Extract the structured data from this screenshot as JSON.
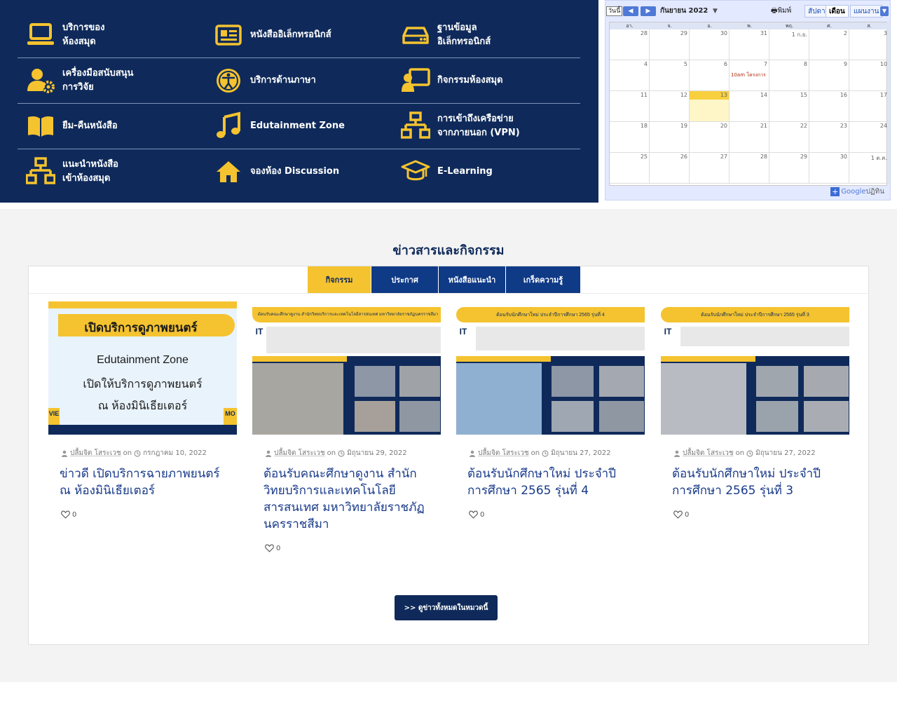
{
  "services": [
    {
      "label": "บริการของ\nห้องสมุด",
      "icon": "laptop-icon"
    },
    {
      "label": "หนังสืออิเล็กทรอนิกส์",
      "icon": "newspaper-icon"
    },
    {
      "label": "ฐานข้อมูล\nอิเล็กทรอนิกส์",
      "icon": "hard-drive-icon"
    },
    {
      "label": "เครื่องมือสนับสนุน\nการวิจัย",
      "icon": "user-gear-icon"
    },
    {
      "label": "บริการด้านภาษา",
      "icon": "accessibility-icon"
    },
    {
      "label": "กิจกรรมห้องสมุด",
      "icon": "presentation-icon"
    },
    {
      "label": "ยืม-คืนหนังสือ",
      "icon": "open-book-icon"
    },
    {
      "label": "Edutainment Zone",
      "icon": "music-note-icon"
    },
    {
      "label": "การเข้าถึงเครือข่าย\nจากภายนอก (VPN)",
      "icon": "network-icon"
    },
    {
      "label": "แนะนำหนังสือ\nเข้าห้องสมุด",
      "icon": "sitemap-icon"
    },
    {
      "label": "จองห้อง Discussion",
      "icon": "home-icon"
    },
    {
      "label": "E-Learning",
      "icon": "graduation-cap-icon"
    }
  ],
  "calendar": {
    "today_button": "วันนี้",
    "prev": "◀",
    "next": "▶",
    "month_label": "กันยายน 2022",
    "print_label": "พิมพ์",
    "view_tabs": [
      "สัปดาห์",
      "เดือน",
      "แผนงาน"
    ],
    "weekdays": [
      "อา.",
      "จ.",
      "อ.",
      "พ.",
      "พฤ.",
      "ศ.",
      "ส."
    ],
    "weeks": [
      [
        "28",
        "29",
        "30",
        "31",
        "1 ก.ย.",
        "2",
        "3"
      ],
      [
        "4",
        "5",
        "6",
        "7",
        "8",
        "9",
        "10"
      ],
      [
        "11",
        "12",
        "13",
        "14",
        "15",
        "16",
        "17"
      ],
      [
        "18",
        "19",
        "20",
        "21",
        "22",
        "23",
        "24"
      ],
      [
        "25",
        "26",
        "27",
        "28",
        "29",
        "30",
        "1 ต.ค."
      ]
    ],
    "today": {
      "week": 2,
      "day": 2
    },
    "event": {
      "week": 1,
      "day": 3,
      "text": "10am โครงการ"
    },
    "google_label": "Google",
    "google_suffix": "ปฏิทิน"
  },
  "news": {
    "title": "ข่าวสารและกิจกรรม",
    "tabs": [
      "กิจกรรม",
      "ประกาศ",
      "หนังสือแนะนำ",
      "เกร็ดความรู้"
    ],
    "active_tab": 0,
    "posts": [
      {
        "author": "ปลื้มจิต โสระเวช",
        "on": "on",
        "date": "กรกฎาคม 10, 2022",
        "title": "ข่าวดี เปิดบริการฉายภาพยนตร์ ณ ห้องมินิเธียเตอร์",
        "likes": "0",
        "thumb": {
          "heading": "เปิดบริการดูภาพยนตร์",
          "line1": "Edutainment Zone",
          "line2": "เปิดให้บริการดูภาพยนตร์",
          "line3": "ณ ห้องมินิเธียเตอร์",
          "left_tag": "VIE",
          "right_tag": "MO"
        }
      },
      {
        "author": "ปลื้มจิต โสระเวช",
        "on": "on",
        "date": "มิถุนายน 29, 2022",
        "title": "ต้อนรับคณะศึกษาดูงาน สำนักวิทยบริการและเทคโนโลยีสารสนเทศ มหาวิทยาลัยราชภัฏนครราชสีมา",
        "likes": "0",
        "thumb": {
          "heading": "ต้อนรับคณะศึกษาดูงาน สำนักวิทยบริการและเทคโนโลยีสารสนเทศ มหาวิทยาลัยราชภัฏนครราชสีมา",
          "logo": "IT"
        }
      },
      {
        "author": "ปลื้มจิต โสระเวช",
        "on": "on",
        "date": "มิถุนายน 27, 2022",
        "title": "ต้อนรับนักศึกษาใหม่ ประจำปีการศึกษา 2565 รุ่นที่ 4",
        "likes": "0",
        "thumb": {
          "heading": "ต้อนรับนักศึกษาใหม่ ประจำปีการศึกษา 2565  รุ่นที่ 4",
          "logo": "IT"
        }
      },
      {
        "author": "ปลื้มจิต โสระเวช",
        "on": "on",
        "date": "มิถุนายน 27, 2022",
        "title": "ต้อนรับนักศึกษาใหม่ ประจำปีการศึกษา 2565 รุ่นที่ 3",
        "likes": "0",
        "thumb": {
          "heading": "ต้อนรับนักศึกษาใหม่ ประจำปีการศึกษา 2565  รุ่นที่ 3",
          "logo": "IT"
        }
      }
    ],
    "all_button": ">> ดูข่าวทั้งหมดในหมวดนี้"
  },
  "colors": {
    "navy": "#0f2a5a",
    "accent_yellow": "#f4c32f",
    "tab_blue": "#0f3a86",
    "title_blue": "#183a8a"
  }
}
